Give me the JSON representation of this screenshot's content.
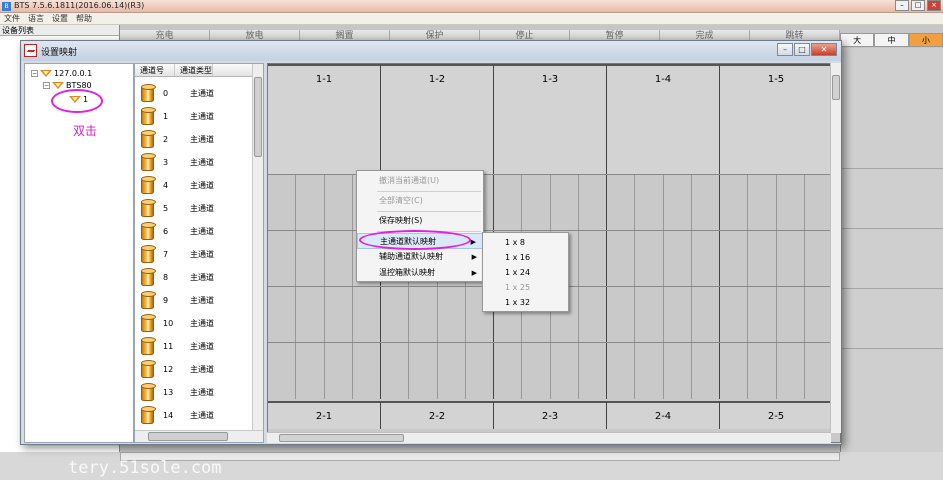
{
  "app": {
    "title": "BTS 7.5.6.1811(2016.06.14)(R3)",
    "menu": [
      "文件",
      "语言",
      "设置",
      "帮助"
    ],
    "device_list_header": "设备列表",
    "toolbar_tabs": [
      "充电",
      "放电",
      "搁置",
      "保护",
      "停止",
      "暂停",
      "完成",
      "跳转"
    ],
    "size_tabs": [
      "大",
      "中",
      "小"
    ],
    "active_size_index": 2,
    "watermark": "tery.51sole.com"
  },
  "dialog": {
    "title": "设置映射",
    "tree": [
      {
        "label": "127.0.0.1",
        "level": 0
      },
      {
        "label": "BTS80",
        "level": 1
      },
      {
        "label": "1",
        "level": 2
      }
    ],
    "hint_label": "双击",
    "channel_list": {
      "headers": [
        "通道号",
        "通道类型"
      ],
      "rows": [
        {
          "num": "0",
          "type": "主通道"
        },
        {
          "num": "1",
          "type": "主通道"
        },
        {
          "num": "2",
          "type": "主通道"
        },
        {
          "num": "3",
          "type": "主通道"
        },
        {
          "num": "4",
          "type": "主通道"
        },
        {
          "num": "5",
          "type": "主通道"
        },
        {
          "num": "6",
          "type": "主通道"
        },
        {
          "num": "7",
          "type": "主通道"
        },
        {
          "num": "8",
          "type": "主通道"
        },
        {
          "num": "9",
          "type": "主通道"
        },
        {
          "num": "10",
          "type": "主通道"
        },
        {
          "num": "11",
          "type": "主通道"
        },
        {
          "num": "12",
          "type": "主通道"
        },
        {
          "num": "13",
          "type": "主通道"
        },
        {
          "num": "14",
          "type": "主通道"
        }
      ]
    },
    "map_columns_top": [
      "1-1",
      "1-2",
      "1-3",
      "1-4",
      "1-5"
    ],
    "map_columns_bottom": [
      "2-1",
      "2-2",
      "2-3",
      "2-4",
      "2-5"
    ]
  },
  "context_menu": {
    "items": [
      {
        "label": "撤消当前通道(U)",
        "disabled": true
      },
      {
        "label": "全部清空(C)",
        "disabled": true
      },
      {
        "label": "保存映射(S)",
        "disabled": false
      },
      {
        "label": "主通道默认映射",
        "disabled": false,
        "submenu": true,
        "highlighted": true
      },
      {
        "label": "辅助通道默认映射",
        "disabled": false,
        "submenu": true
      },
      {
        "label": "温控箱默认映射",
        "disabled": false,
        "submenu": true
      }
    ],
    "submenu": [
      {
        "label": "1 x 8",
        "disabled": false
      },
      {
        "label": "1 x 16",
        "disabled": false
      },
      {
        "label": "1 x 24",
        "disabled": false
      },
      {
        "label": "1 x 25",
        "disabled": true
      },
      {
        "label": "1 x 32",
        "disabled": false
      }
    ]
  }
}
